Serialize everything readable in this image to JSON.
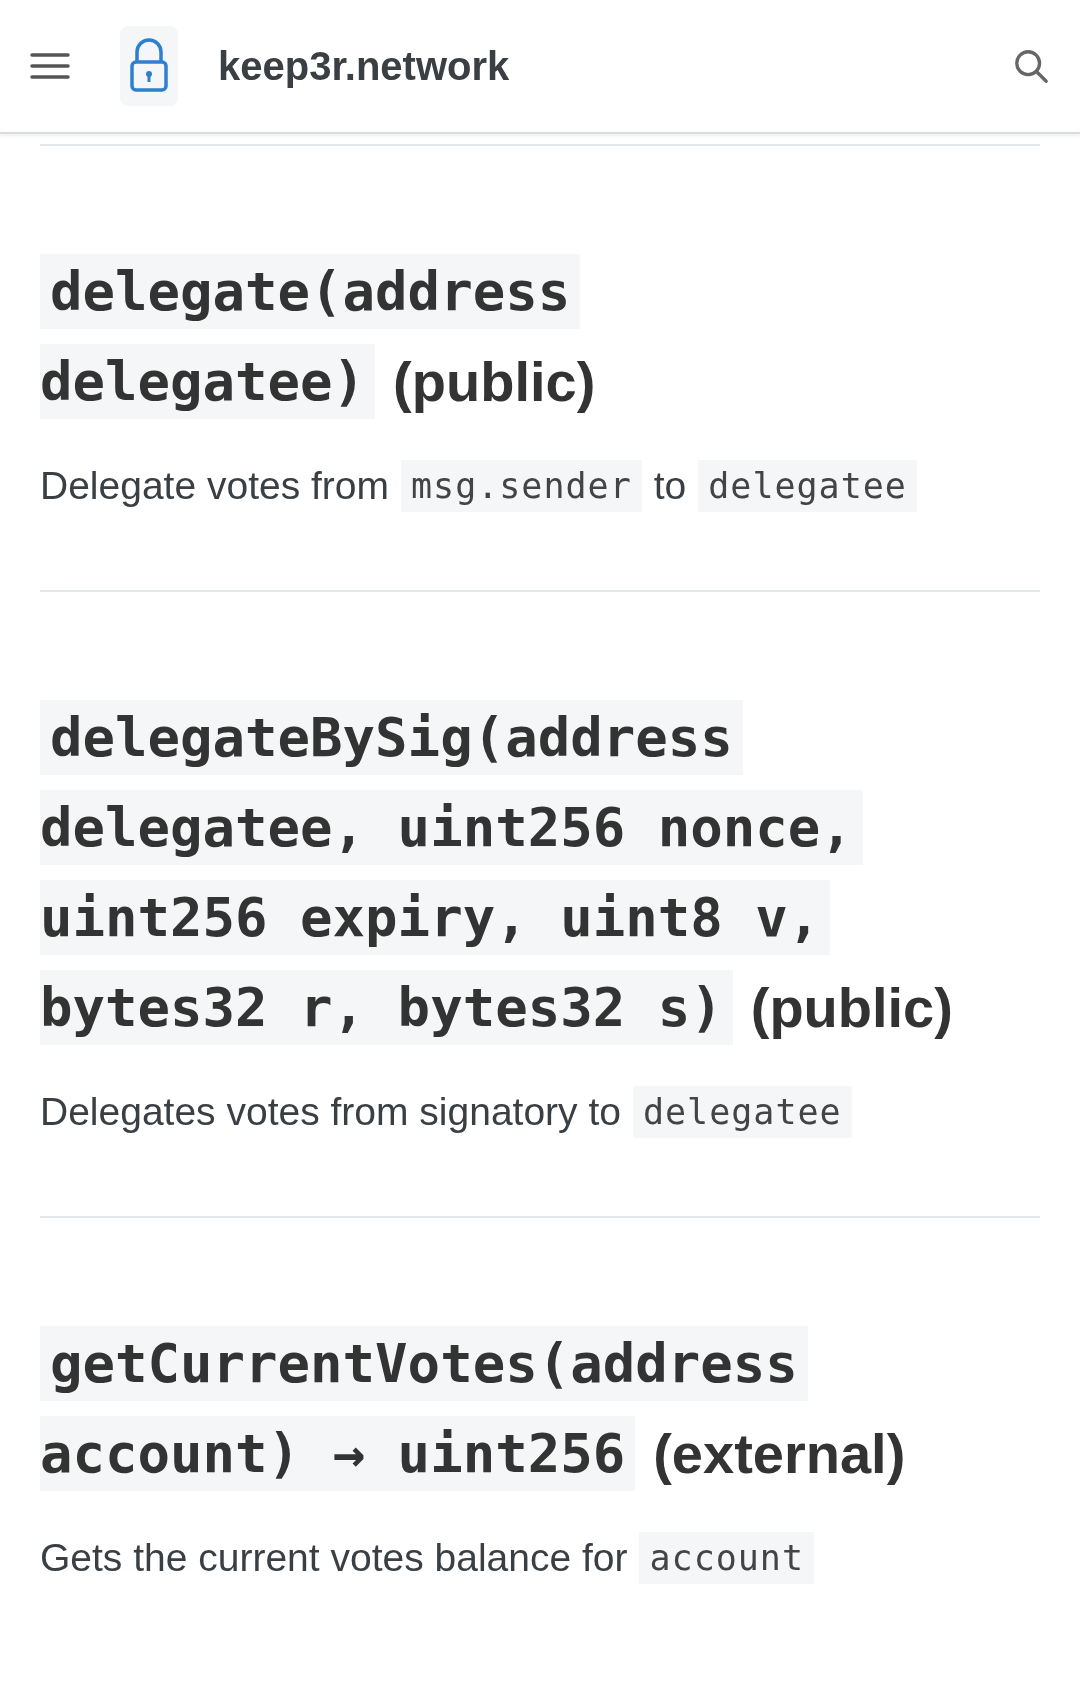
{
  "header": {
    "title": "keep3r.network"
  },
  "sections": [
    {
      "heading_lines": [
        "delegate(address",
        "delegatee)"
      ],
      "visibility": "(public)",
      "description": [
        {
          "kind": "text",
          "text": "Delegate votes from"
        },
        {
          "kind": "code",
          "text": "msg.sender"
        },
        {
          "kind": "text",
          "text": "to"
        },
        {
          "kind": "code",
          "text": "delegatee"
        }
      ]
    },
    {
      "heading_lines": [
        "delegateBySig(address",
        "delegatee, uint256 nonce,",
        "uint256 expiry, uint8 v,",
        "bytes32 r, bytes32 s)"
      ],
      "visibility": "(public)",
      "description": [
        {
          "kind": "text",
          "text": "Delegates votes from signatory to"
        },
        {
          "kind": "code",
          "text": "delegatee"
        }
      ]
    },
    {
      "heading_lines": [
        "getCurrentVotes(address",
        "account) → uint256"
      ],
      "visibility": "(external)",
      "description": [
        {
          "kind": "text",
          "text": "Gets the current votes balance for"
        },
        {
          "kind": "code",
          "text": "account"
        }
      ]
    }
  ]
}
